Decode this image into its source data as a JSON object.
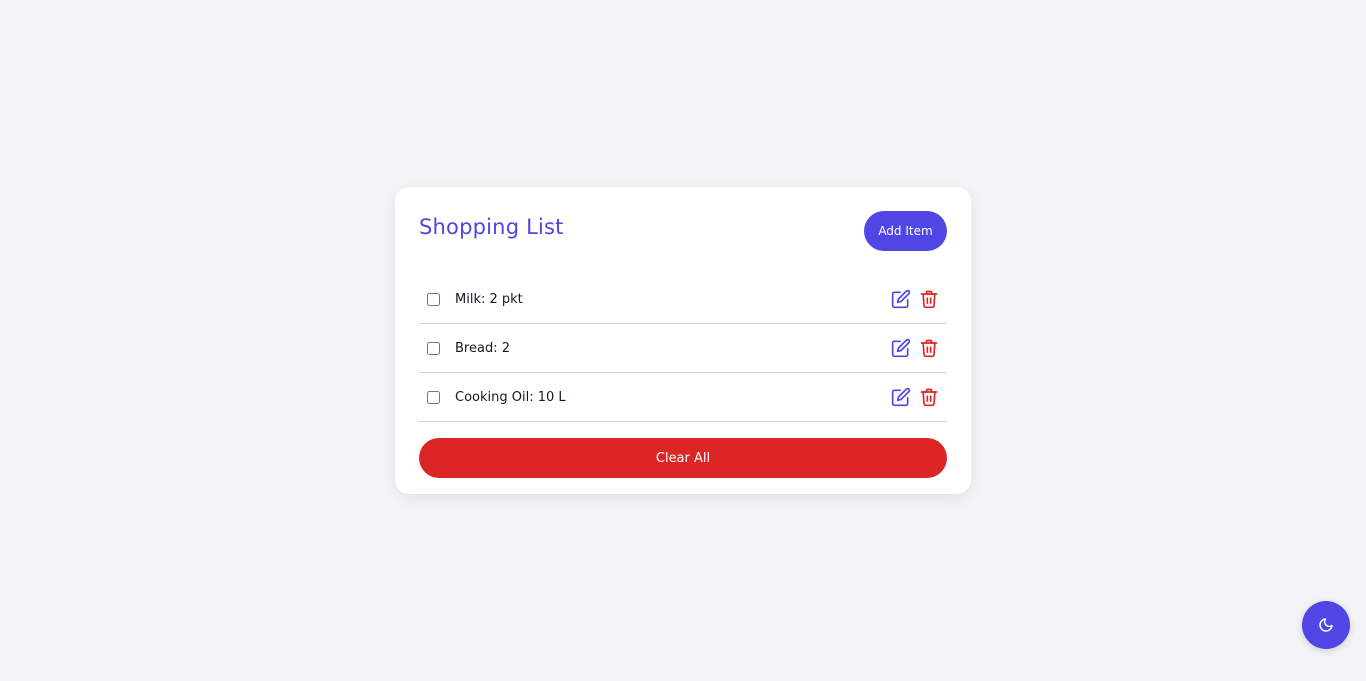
{
  "header": {
    "title": "Shopping List",
    "add_label": "Add Item"
  },
  "items": [
    {
      "text": "Milk: 2 pkt",
      "checked": false
    },
    {
      "text": "Bread: 2",
      "checked": false
    },
    {
      "text": "Cooking Oil: 10 L",
      "checked": false
    }
  ],
  "footer": {
    "clear_label": "Clear All"
  },
  "theme_toggle": {
    "icon": "moon-icon"
  },
  "colors": {
    "accent": "#4f46e5",
    "danger": "#dc2626",
    "background": "#f3f4f6",
    "card": "#ffffff"
  }
}
